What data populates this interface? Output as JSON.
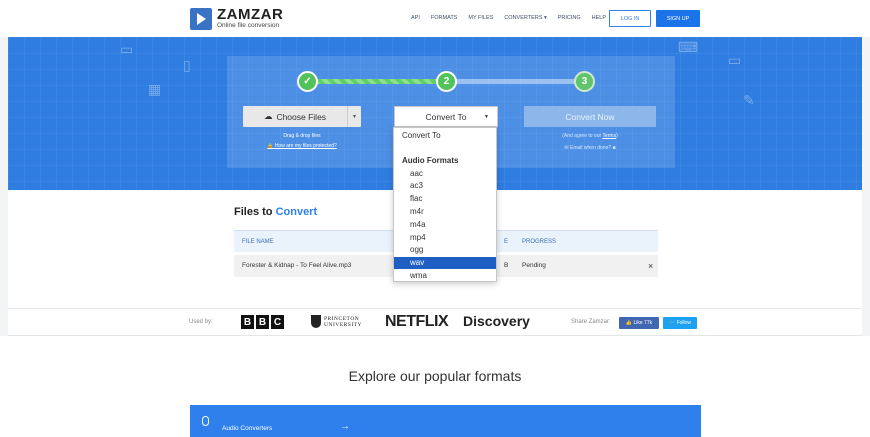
{
  "header": {
    "brand": "ZAMZAR",
    "tagline": "Online file conversion",
    "nav": [
      "API",
      "FORMATS",
      "MY FILES",
      "CONVERTERS ▾",
      "PRICING",
      "HELP"
    ],
    "login": "LOG IN",
    "signup": "SIGN UP"
  },
  "converter": {
    "steps": [
      "✓",
      "2",
      "3"
    ],
    "choose_files": "Choose Files",
    "drag_drop": "Drag & drop files",
    "protected": "How are my files protected?",
    "convert_to": "Convert To",
    "convert_now": "Convert Now",
    "agree_prefix": "(And agree to our ",
    "agree_link": "Terms",
    "agree_suffix": ")",
    "email_done": "Email when done?"
  },
  "dropdown": {
    "first": "Convert To",
    "group": "Audio Formats",
    "options": [
      "aac",
      "ac3",
      "flac",
      "m4r",
      "m4a",
      "mp4",
      "ogg",
      "wav",
      "wma"
    ],
    "selected": "wav"
  },
  "files": {
    "title_prefix": "Files to ",
    "title_accent": "Convert",
    "columns": {
      "file_name": "FILE NAME",
      "size_tail": "E",
      "progress": "PROGRESS"
    },
    "row": {
      "file_name": "Forester & Kidnap - To Feel Alive.mp3",
      "size_tail": "B",
      "progress": "Pending",
      "remove": "×"
    }
  },
  "used_by": {
    "label": "Used by:",
    "bbc": [
      "B",
      "B",
      "C"
    ],
    "princeton": [
      "PRINCETON",
      "UNIVERSITY"
    ],
    "netflix": "NETFLIX",
    "discovery": "Discovery",
    "share_label": "Share Zamzar:",
    "like": "👍 Like 77k",
    "follow": "🐦 Follow"
  },
  "explore": {
    "title": "Explore our popular formats",
    "audio_label": "Audio Converters",
    "arrow": "→"
  },
  "colors": {
    "primary": "#2f80ed",
    "hero": "#2f7de1",
    "step_green": "#52c35a",
    "selected": "#1f5fc4"
  }
}
